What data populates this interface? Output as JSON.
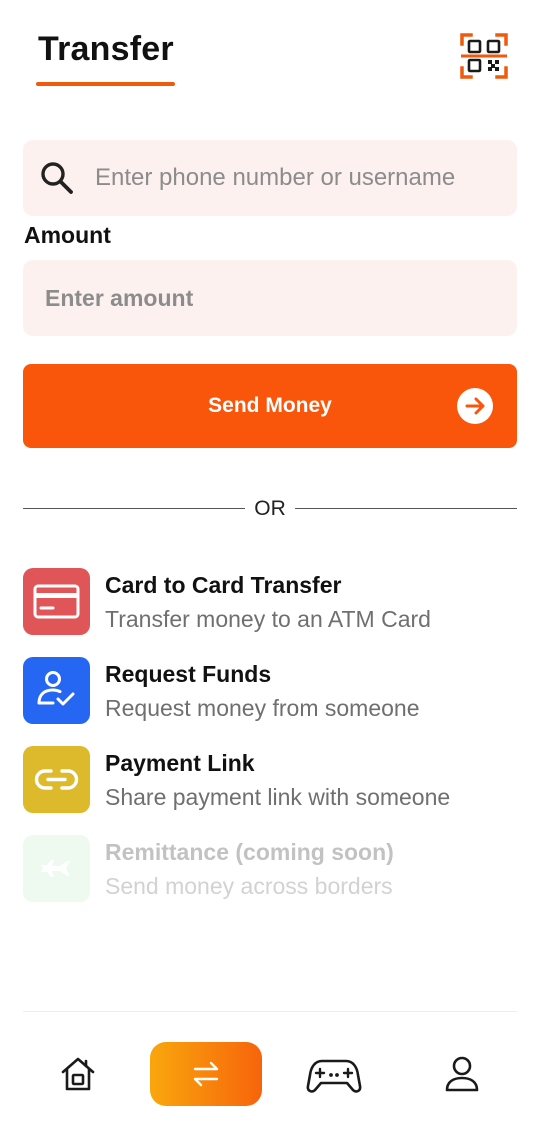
{
  "header": {
    "title": "Transfer",
    "qr_icon": "qr-code-scan-icon"
  },
  "search": {
    "icon": "search-icon",
    "placeholder": "Enter phone number or username",
    "value": ""
  },
  "amount": {
    "label": "Amount",
    "placeholder": "Enter amount",
    "value": ""
  },
  "send_button": {
    "label": "Send Money",
    "icon": "arrow-right-circle-icon"
  },
  "divider": {
    "text": "OR"
  },
  "options": [
    {
      "title": "Card to Card Transfer",
      "subtitle": "Transfer money to an ATM Card",
      "icon": "credit-card-icon",
      "color": "#e05557",
      "enabled": true
    },
    {
      "title": "Request Funds",
      "subtitle": "Request money from someone",
      "icon": "user-check-icon",
      "color": "#2566f2",
      "enabled": true
    },
    {
      "title": "Payment Link",
      "subtitle": "Share payment link with someone",
      "icon": "link-icon",
      "color": "#dcba2b",
      "enabled": true
    },
    {
      "title": "Remittance (coming soon)",
      "subtitle": "Send money across borders",
      "icon": "airplane-icon",
      "color": "#eefaf0",
      "enabled": false
    }
  ],
  "bottom_nav": {
    "items": [
      {
        "name": "home",
        "icon": "home-icon",
        "active": false
      },
      {
        "name": "transfer",
        "icon": "transfer-arrows-icon",
        "active": true
      },
      {
        "name": "games",
        "icon": "gamepad-icon",
        "active": false
      },
      {
        "name": "profile",
        "icon": "user-icon",
        "active": false
      }
    ]
  },
  "colors": {
    "accent": "#f9560c",
    "input_bg": "#fdf1ef",
    "nav_gradient_start": "#f9a70d",
    "nav_gradient_end": "#f7640b"
  }
}
